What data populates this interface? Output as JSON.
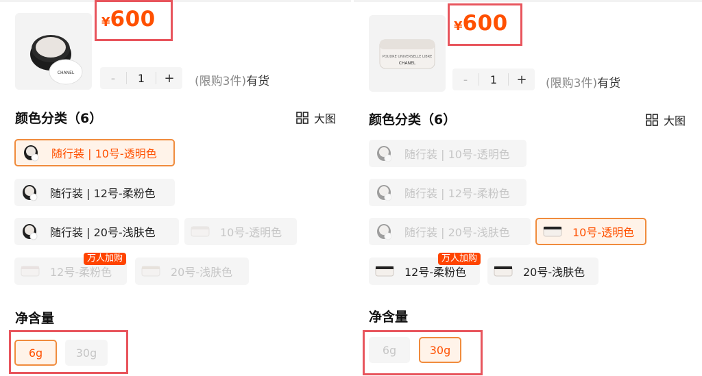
{
  "left": {
    "price": {
      "currency": "¥",
      "amount": "600"
    },
    "stepper": {
      "minus": "-",
      "qty": "1",
      "plus": "+"
    },
    "stock": {
      "limit": "(限购3件)",
      "status": "有货"
    },
    "color_title": "颜色分类（6）",
    "big_view": "大图",
    "options": [
      {
        "label": "随行装 | 10号-透明色",
        "state": "selected"
      },
      {
        "label": "随行装 | 12号-柔粉色",
        "state": "normal"
      },
      {
        "label": "随行装 | 20号-浅肤色",
        "state": "normal"
      },
      {
        "label": "10号-透明色",
        "state": "disabled"
      },
      {
        "label": "12号-柔粉色",
        "state": "disabled",
        "badge": "万人加购"
      },
      {
        "label": "20号-浅肤色",
        "state": "disabled"
      }
    ],
    "size_title": "净含量",
    "sizes": [
      {
        "label": "6g",
        "state": "selected"
      },
      {
        "label": "30g",
        "state": "disabled"
      }
    ]
  },
  "right": {
    "price": {
      "currency": "¥",
      "amount": "600"
    },
    "stepper": {
      "minus": "-",
      "qty": "1",
      "plus": "+"
    },
    "stock": {
      "limit": "(限购3件)",
      "status": "有货"
    },
    "color_title": "颜色分类（6）",
    "big_view": "大图",
    "options": [
      {
        "label": "随行装 | 10号-透明色",
        "state": "disabled"
      },
      {
        "label": "随行装 | 12号-柔粉色",
        "state": "disabled"
      },
      {
        "label": "随行装 | 20号-浅肤色",
        "state": "disabled"
      },
      {
        "label": "10号-透明色",
        "state": "selected"
      },
      {
        "label": "12号-柔粉色",
        "state": "normal",
        "badge": "万人加购"
      },
      {
        "label": "20号-浅肤色",
        "state": "normal"
      }
    ],
    "size_title": "净含量",
    "sizes": [
      {
        "label": "6g",
        "state": "disabled"
      },
      {
        "label": "30g",
        "state": "selected"
      }
    ]
  },
  "colors": {
    "accent": "#ff5000",
    "highlight_border": "#e8545c",
    "selected_border": "#f08b3c",
    "disabled_text": "#c6c6c6"
  }
}
